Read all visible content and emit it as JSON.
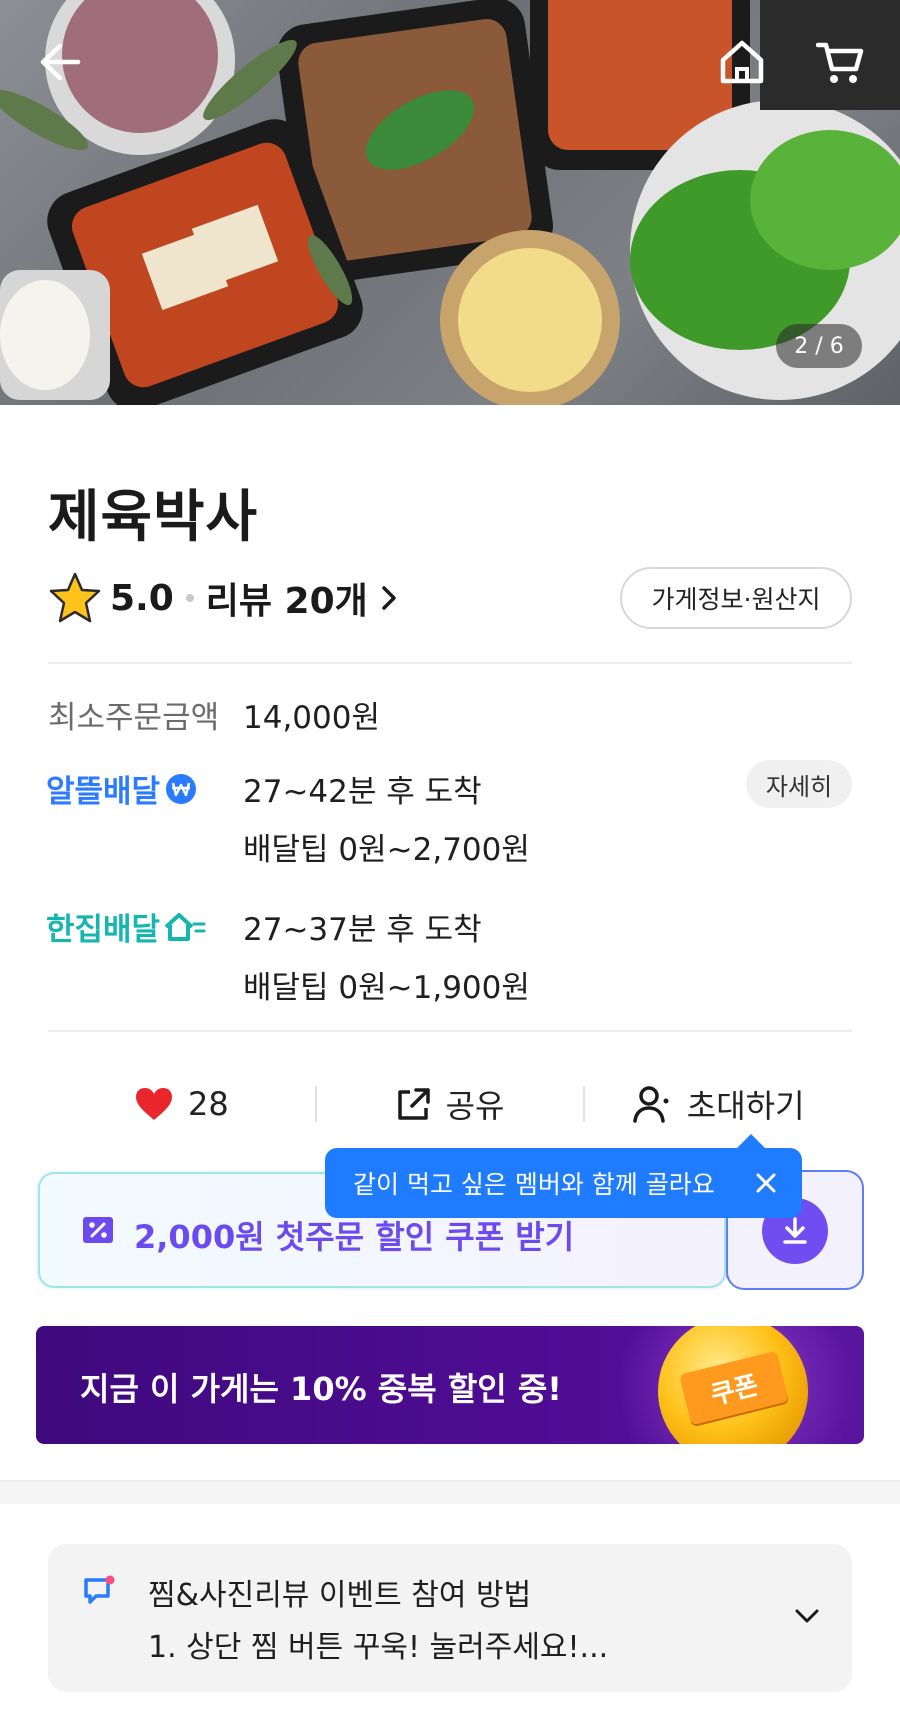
{
  "hero": {
    "image_alt": "",
    "counter": "2 / 6",
    "icons": [
      "back-arrow-icon",
      "home-icon",
      "cart-icon"
    ]
  },
  "store": {
    "name": "제육박사",
    "rating": "5.0",
    "reviews_label": "리뷰 20개",
    "info_button": "가게정보·원산지"
  },
  "delivery": {
    "min_order_label": "최소주문금액",
    "min_order_value": "14,000원",
    "economy": {
      "brand": "알뜰배달",
      "eta": "27~42분 후 도착",
      "tip": "배달팁 0원~2,700원",
      "detail_button": "자세히"
    },
    "single": {
      "brand": "한집배달",
      "eta": "27~37분 후 도착",
      "tip": "배달팁 0원~1,900원"
    }
  },
  "actions": {
    "likes": "28",
    "share": "공유",
    "invite": "초대하기"
  },
  "tooltip": {
    "text": "같이 먹고 싶은 멤버와 함께 골라요"
  },
  "coupon": {
    "text": "2,000원 첫주문 할인 쿠폰 받기"
  },
  "banner": {
    "text": "지금 이 가게는 10% 중복 할인 중!",
    "badge": "쿠폰"
  },
  "event": {
    "title": "찜&사진리뷰 이벤트 참여 방법",
    "subtitle": "1. 상단 찜 버튼 꾸욱! 눌러주세요!..."
  },
  "colors": {
    "accent_blue": "#1f7bff",
    "teal": "#14b6ad",
    "purple": "#6f4df0",
    "banner_purple": "#4e0c93",
    "heart_red": "#e8262c"
  }
}
